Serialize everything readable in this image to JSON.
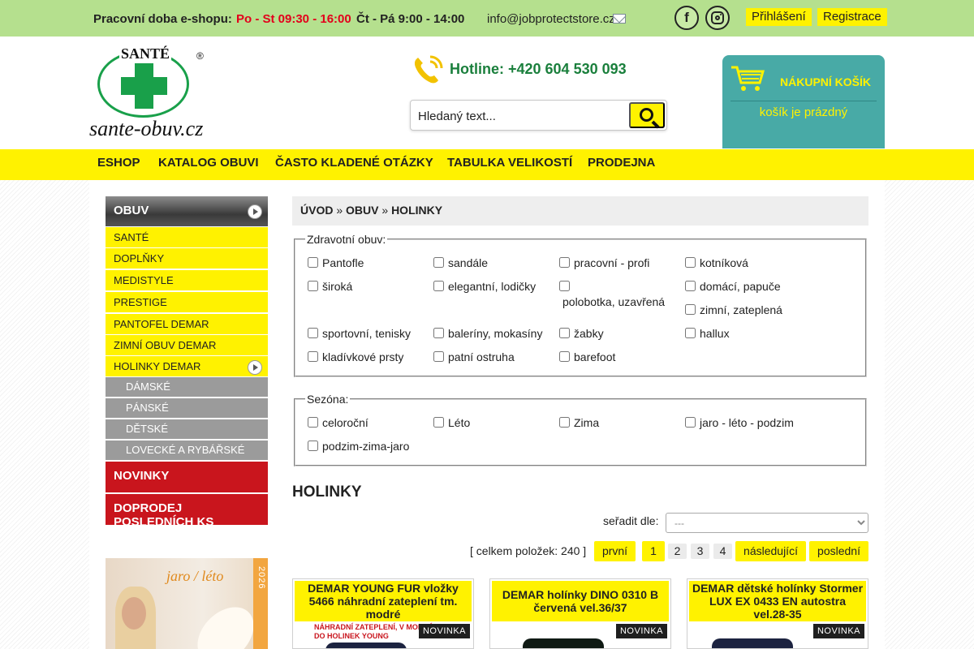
{
  "topbar": {
    "hours_label": "Pracovní doba e-shopu:",
    "hours_1": "Po - St 09:30 - 16:00",
    "hours_2": "Čt - Pá 9:00 - 14:00",
    "email": "info@jobprotectstore.cz",
    "facebook_icon": "facebook-icon",
    "instagram_icon": "instagram-icon",
    "login": "Přihlášení",
    "register": "Registrace"
  },
  "header": {
    "logo_brand": "SANTÉ",
    "logo_reg": "®",
    "logo_url": "sante-obuv.cz",
    "hotline": "Hotline:  +420 604 530 093",
    "search_placeholder": "Hledaný text...",
    "cart_title": "NÁKUPNÍ KOŠÍK",
    "cart_status": "košík je prázdný"
  },
  "nav": [
    "ESHOP",
    "KATALOG OBUVI",
    "ČASTO KLADENÉ OTÁZKY",
    "TABULKA VELIKOSTÍ",
    "PRODEJNA"
  ],
  "sidebar": {
    "head": "OBUV",
    "items": [
      "SANTÉ",
      "DOPLŇKY",
      "MEDISTYLE",
      "PRESTIGE",
      "PANTOFEL DEMAR",
      "ZIMNÍ OBUV DEMAR",
      "HOLINKY DEMAR"
    ],
    "sub_items": [
      "DÁMSKÉ",
      "PÁNSKÉ",
      "DĚTSKÉ",
      "LOVECKÉ A RYBÁŘSKÉ"
    ],
    "novinky": "NOVINKY",
    "doprodej": "DOPRODEJ POSLEDNÍCH KS",
    "promo_text": "jaro / léto",
    "promo_year": "2026"
  },
  "breadcrumb": {
    "home": "ÚVOD",
    "sep": "»",
    "category": "OBUV",
    "current": "HOLINKY"
  },
  "filters": {
    "health_legend": "Zdravotní obuv:",
    "health_options": [
      "Pantofle",
      "sandále",
      "pracovní - profi",
      "kotníková",
      "široká",
      "elegantní, lodičky",
      "polobotka, uzavřená",
      "domácí, papuče",
      "zimní, zateplená",
      "sportovní, tenisky",
      "baleríny, mokasíny",
      "žabky",
      "hallux",
      "kladívkové prsty",
      "patní ostruha",
      "barefoot"
    ],
    "season_legend": "Sezóna:",
    "season_options": [
      "celoroční",
      "Léto",
      "Zima",
      "jaro - léto - podzim",
      "podzim-zima-jaro"
    ]
  },
  "listing": {
    "heading": "HOLINKY",
    "sort_label": "seřadit dle:",
    "sort_selected": "---",
    "total": "[ celkem položek: 240 ]",
    "first": "první",
    "pages": [
      "1",
      "2",
      "3",
      "4"
    ],
    "next": "následující",
    "last": "poslední"
  },
  "products": [
    {
      "title": "DEMAR YOUNG FUR vložky 5466 náhradní zateplení tm. modré",
      "badge": "NOVINKA",
      "image_text": "NÁHRADNÍ ZATEPLENÍ, V modré, do holinek YOUNG"
    },
    {
      "title": "DEMAR holínky DINO 0310 B červená vel.36/37",
      "badge": "NOVINKA"
    },
    {
      "title": "DEMAR dětské holínky Stormer LUX EX 0433 EN autostra vel.28-35",
      "badge": "NOVINKA"
    }
  ],
  "colors": {
    "topbar": "#b5e08e",
    "accent_yellow": "#fff200",
    "brand_green": "#19a04a",
    "cart_teal": "#48aaa6",
    "red": "#c9151d"
  }
}
